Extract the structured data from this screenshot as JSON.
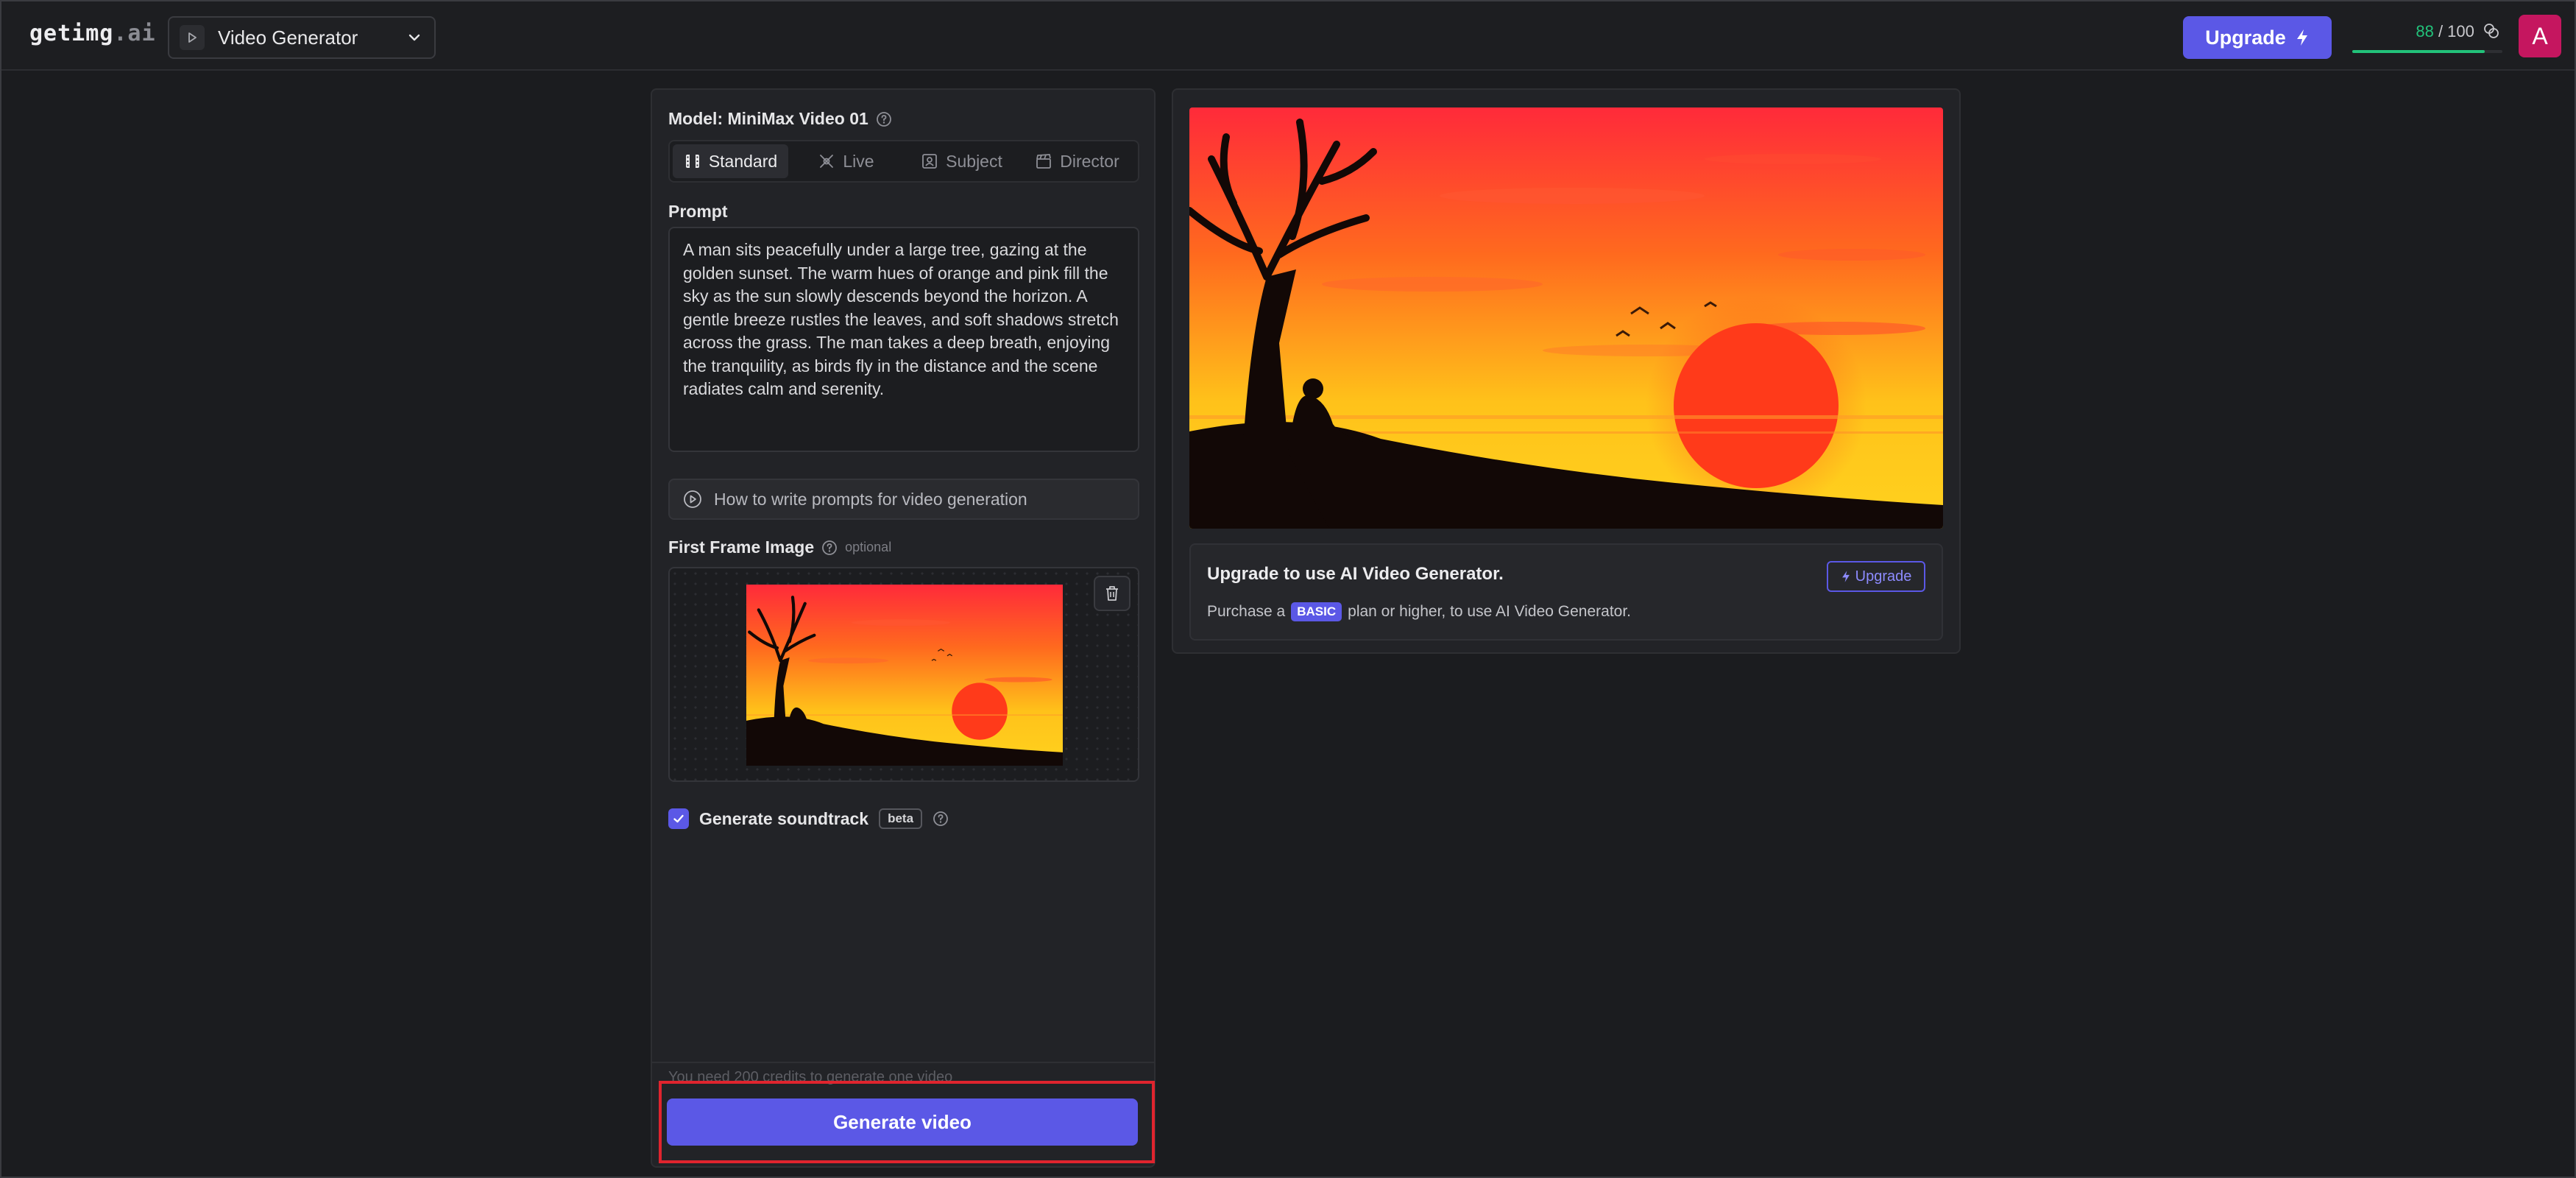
{
  "header": {
    "logo_main": "getimg",
    "logo_suffix": ".ai",
    "tool_select": {
      "value": "Video Generator"
    },
    "upgrade_label": "Upgrade",
    "credits": {
      "used": "88",
      "total": "/ 100",
      "fraction": 0.88
    },
    "avatar_letter": "A"
  },
  "left_panel": {
    "model_label": "Model: MiniMax Video 01",
    "tabs": [
      {
        "label": "Standard",
        "icon": "film-icon",
        "active": true
      },
      {
        "label": "Live",
        "icon": "sparkle-live-icon",
        "active": false
      },
      {
        "label": "Subject",
        "icon": "portrait-icon",
        "active": false
      },
      {
        "label": "Director",
        "icon": "clapperboard-icon",
        "active": false
      }
    ],
    "prompt_title": "Prompt",
    "prompt_text": "A man sits peacefully under a large tree, gazing at the golden sunset. The warm hues of orange and pink fill the sky as the sun slowly descends beyond the horizon. A gentle breeze rustles the leaves, and soft shadows stretch across the grass. The man takes a deep breath, enjoying the tranquility, as birds fly in the distance and the scene radiates calm and serenity.",
    "howto_label": "How to write prompts for video generation",
    "first_frame_title": "First Frame Image",
    "first_frame_optional": "optional",
    "soundtrack_label": "Generate soundtrack",
    "soundtrack_checked": true,
    "beta_badge": "beta",
    "credits_note": "You need 200 credits to generate one video",
    "generate_label": "Generate video"
  },
  "right_panel": {
    "card_title": "Upgrade to use AI Video Generator.",
    "card_desc_before": "Purchase a",
    "card_badge": "BASIC",
    "card_desc_after": "plan or higher, to use AI Video Generator.",
    "card_upgrade_label": "Upgrade"
  },
  "colors": {
    "accent": "#5b58e6",
    "credit_green": "#22c27a",
    "avatar": "#c5165f",
    "highlight_red": "#e0242e"
  }
}
